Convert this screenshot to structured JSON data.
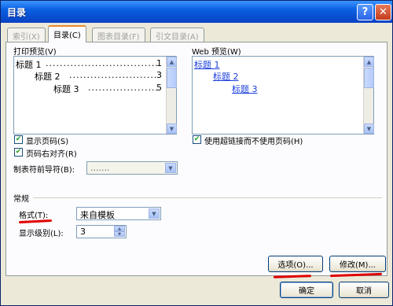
{
  "window": {
    "title": "目录",
    "help_glyph": "?",
    "close_glyph": "✕"
  },
  "tabs": [
    {
      "label": "索引(X)",
      "active": false
    },
    {
      "label": "目录(C)",
      "active": true
    },
    {
      "label": "图表目录(F)",
      "active": false
    },
    {
      "label": "引文目录(A)",
      "active": false
    }
  ],
  "print_preview": {
    "label": "打印预览(V)",
    "lines": [
      {
        "text": "标题 1",
        "page": "1"
      },
      {
        "text": "标题 2",
        "page": "3"
      },
      {
        "text": "标题 3",
        "page": "5"
      }
    ]
  },
  "web_preview": {
    "label": "Web 预览(W)",
    "lines": [
      "标题 1",
      "标题 2",
      "标题 3"
    ]
  },
  "options": {
    "show_page_numbers": {
      "label": "显示页码(S)",
      "checked": true
    },
    "right_align": {
      "label": "页码右对齐(R)",
      "checked": true
    },
    "tab_leader": {
      "label": "制表符前导符(B):",
      "value": "......."
    },
    "use_hyperlinks": {
      "label": "使用超链接而不使用页码(H)",
      "checked": true
    }
  },
  "general": {
    "heading": "常规",
    "format": {
      "label": "格式(T):",
      "value": "来自模板"
    },
    "levels": {
      "label": "显示级别(L):",
      "value": "3"
    }
  },
  "buttons": {
    "options": "选项(O)...",
    "modify": "修改(M)...",
    "ok": "确定",
    "cancel": "取消"
  },
  "colors": {
    "title_bar": "#0a5fe0",
    "annotation_red": "#e00000",
    "link_blue": "#1a3edb"
  }
}
